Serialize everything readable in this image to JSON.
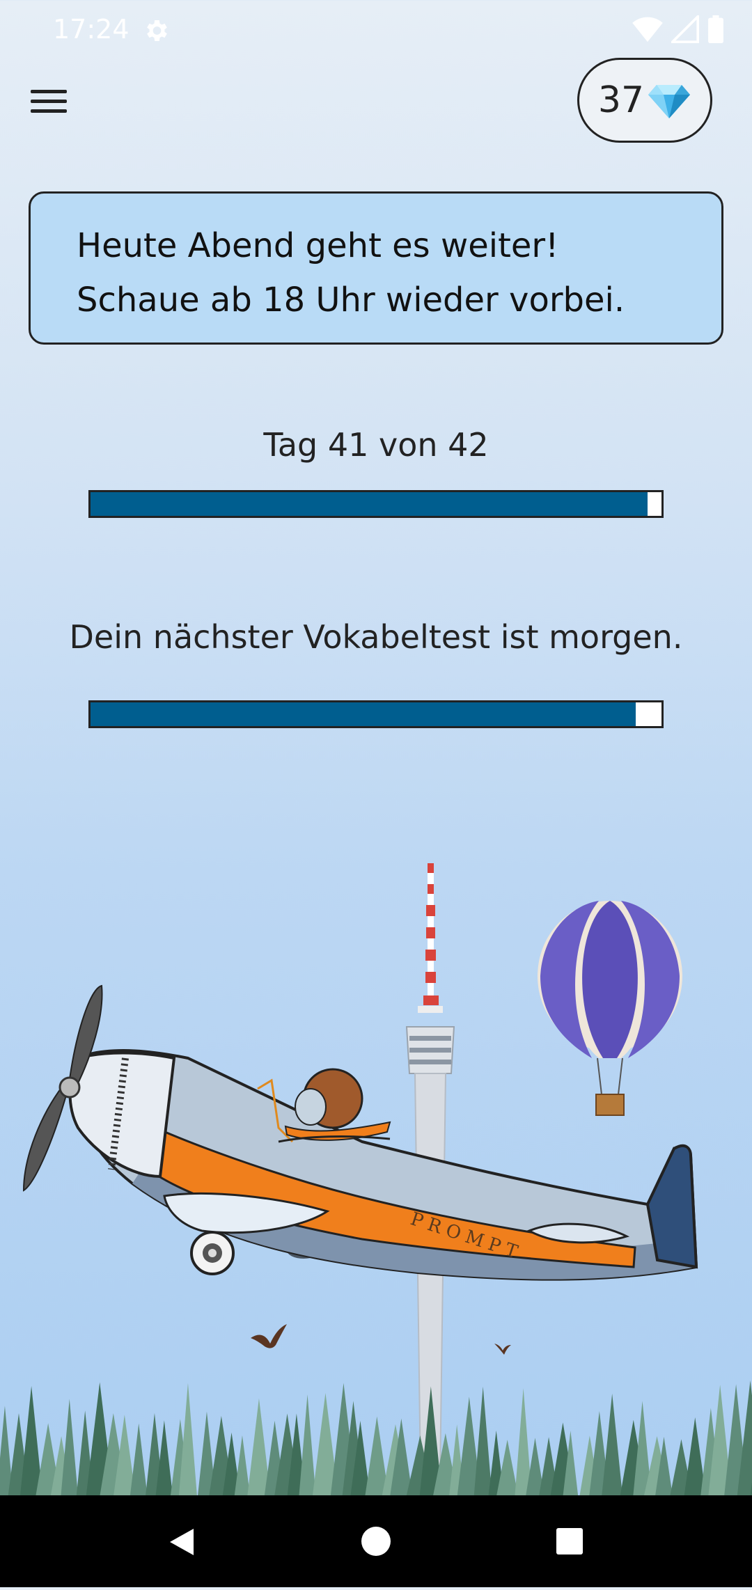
{
  "status_bar": {
    "time": "17:24",
    "icons": [
      "settings-icon",
      "wifi-icon",
      "signal-icon",
      "battery-icon"
    ]
  },
  "header": {
    "menu_icon": "hamburger-menu-icon",
    "gems": "37",
    "gem_icon": "diamond-icon"
  },
  "message": "Heute Abend geht es weiter! Schaue ab 18 Uhr wieder vorbei.",
  "progress_day": {
    "label": "Tag 41 von 42",
    "value": 0.976
  },
  "progress_test": {
    "label": "Dein nächster Vokabeltest ist morgen.",
    "value": 0.955
  },
  "illustration": {
    "plane_text": "PROMPT"
  },
  "nav_bar": {
    "icons": [
      "back-icon",
      "home-icon",
      "recents-icon"
    ]
  },
  "colors": {
    "accent": "#005e8f",
    "message_bg": "#b9dbf6",
    "plane_orange": "#f07f1c"
  }
}
